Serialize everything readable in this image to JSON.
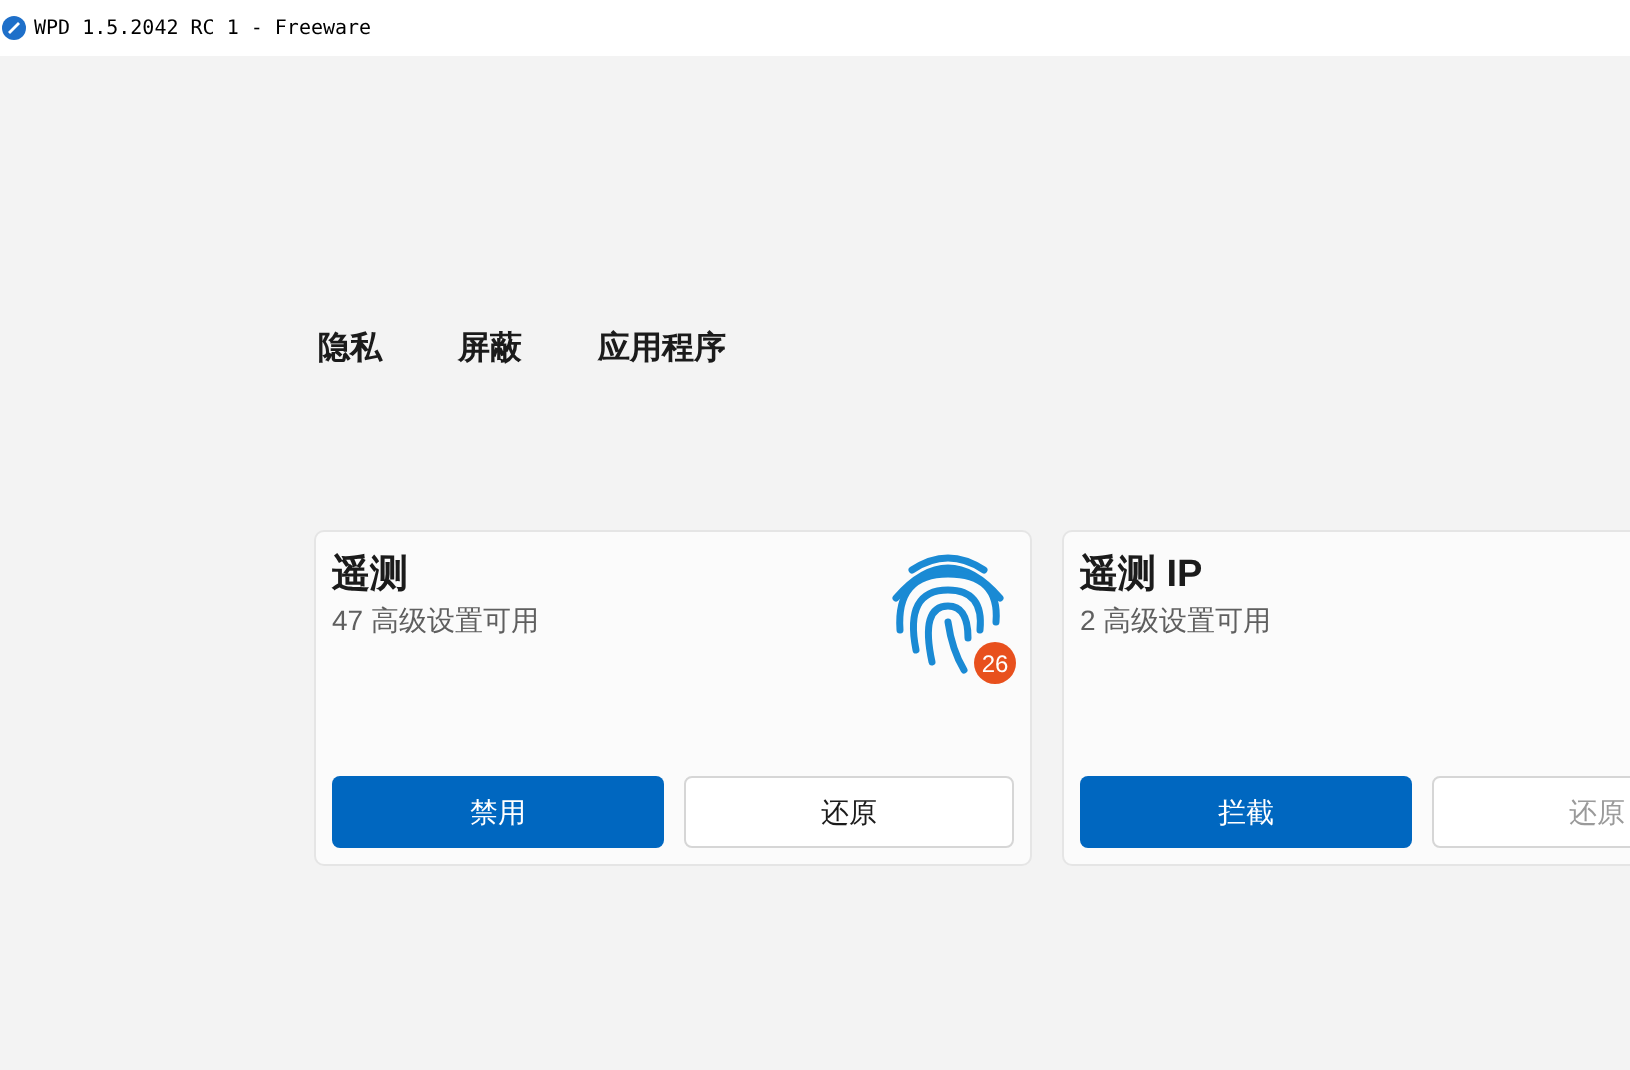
{
  "window": {
    "title": "WPD 1.5.2042 RC 1 - Freeware"
  },
  "nav": [
    {
      "label": "隐私"
    },
    {
      "label": "屏蔽"
    },
    {
      "label": "应用程序"
    }
  ],
  "cards": [
    {
      "title": "遥测",
      "subtitle": "47 高级设置可用",
      "badge": "26",
      "buttons": [
        {
          "label": "禁用",
          "kind": "primary",
          "disabled": false
        },
        {
          "label": "还原",
          "kind": "secondary",
          "disabled": false
        }
      ]
    },
    {
      "title": "遥测 IP",
      "subtitle": "2 高级设置可用",
      "buttons": [
        {
          "label": "拦截",
          "kind": "primary",
          "disabled": false
        },
        {
          "label": "还原",
          "kind": "secondary",
          "disabled": true
        }
      ]
    }
  ]
}
